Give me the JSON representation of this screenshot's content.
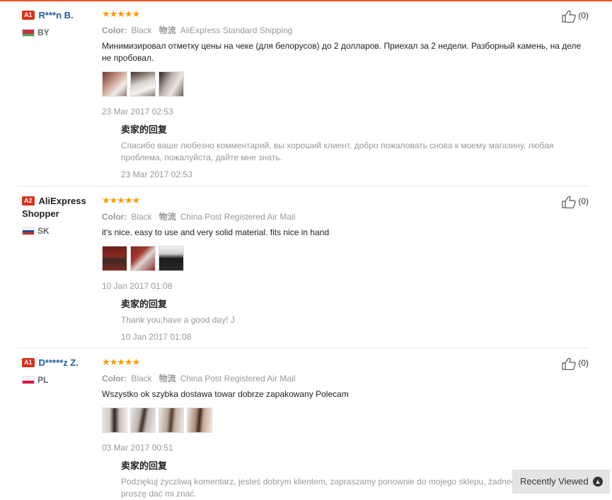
{
  "labels": {
    "color_label": "Color:",
    "shipping_label": "物流",
    "seller_reply_title": "卖家的回复",
    "rating_stars": "★★★★★"
  },
  "reviews": [
    {
      "level": "A1",
      "name": "R***n B.",
      "country": "BY",
      "color": "Black",
      "shipping": "AliExpress Standard Shipping",
      "text": "Минимизировал отметку цены на чеке (для белорусов) до 2 долларов. Приехал за 2 недели. Разборный камень, на деле не пробовал.",
      "date": "23 Mar 2017 02:53",
      "reply_text": "Спасибо ваше любезно комментарий, вы хороший клиент, добро пожаловать снова к моему магазину, любая проблема, пожалуйста, дайте мне знать.",
      "reply_date": "23 Mar 2017 02:53",
      "useful": "(0)"
    },
    {
      "level": "A2",
      "name": "AliExpress Shopper",
      "country": "SK",
      "color": "Black",
      "shipping": "China Post Registered Air Mail",
      "text": "it's nice. easy to use and very solid material. fits nice in hand",
      "date": "10 Jan 2017 01:08",
      "reply_text": "Thank you,have a good day! J",
      "reply_date": "10 Jan 2017 01:08",
      "useful": "(0)"
    },
    {
      "level": "A1",
      "name": "D*****z Z.",
      "country": "PL",
      "color": "Black",
      "shipping": "China Post Registered Air Mail",
      "text": "Wszystko ok szybka dostawa towar dobrze zapakowany Polecam",
      "date": "03 Mar 2017 00:51",
      "reply_text": "Podziękuj życzliwą komentarz, jesteś dobrym klientem, zapraszamy ponownie do mojego sklepu, żadnego problemu, proszę dać mi znać.",
      "useful": "(0)"
    }
  ],
  "recently_viewed": "Recently Viewed",
  "colors": {
    "accent": "#e5581f",
    "star": "#ff9900",
    "level_badge": "#d9301b",
    "name_link": "#1f5a9e"
  }
}
